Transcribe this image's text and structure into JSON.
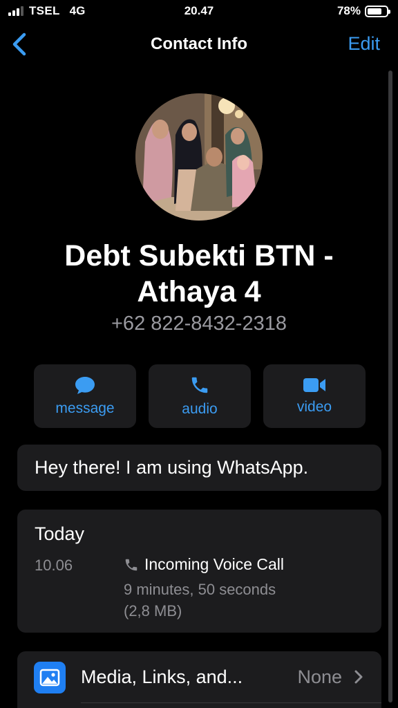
{
  "status_bar": {
    "carrier": "TSEL",
    "network": "4G",
    "time": "20.47",
    "battery": "78%",
    "battery_level": 0.78,
    "signal_icon": "signal-bars-icon",
    "battery_icon": "battery-icon"
  },
  "nav": {
    "back_icon": "chevron-left-icon",
    "title": "Contact Info",
    "edit_label": "Edit"
  },
  "contact": {
    "name": "Debt Subekti  BTN - Athaya 4",
    "phone": "+62 822-8432-2318"
  },
  "actions": [
    {
      "label": "message",
      "icon": "chat-bubble-icon"
    },
    {
      "label": "audio",
      "icon": "phone-icon"
    },
    {
      "label": "video",
      "icon": "video-camera-icon"
    }
  ],
  "about": {
    "text": "Hey there! I am using WhatsApp."
  },
  "call_log": {
    "date": "Today",
    "time": "10.06",
    "type": "Incoming Voice Call",
    "duration": "9 minutes, 50 seconds",
    "size": "(2,8 MB)"
  },
  "media_row": {
    "label": "Media, Links, and...",
    "value": "None",
    "icon": "photo-icon"
  },
  "colors": {
    "accent": "#3b9cf2",
    "card": "#1c1c1e",
    "secondary_text": "#8e8e93",
    "media_icon_bg": "#1f7ff2"
  }
}
